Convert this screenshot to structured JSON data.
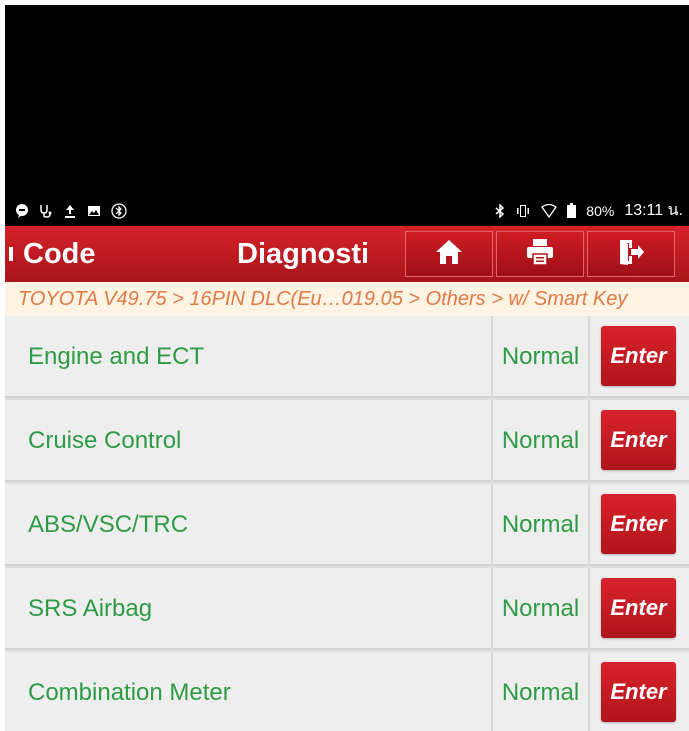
{
  "statusbar": {
    "left_icons": [
      "message-icon",
      "stethoscope-icon",
      "upload-icon",
      "image-icon",
      "bluetooth-circle-icon"
    ],
    "right_icons": [
      "bluetooth-icon",
      "vibrate-icon",
      "wifi-icon",
      "battery-icon"
    ],
    "battery": "80%",
    "time": "13:11 น."
  },
  "titlebar": {
    "left_title": "Code",
    "center_title": "Diagnosti",
    "buttons": [
      "home-icon",
      "print-icon",
      "exit-icon"
    ]
  },
  "breadcrumb": "TOYOTA V49.75 > 16PIN DLC(Eu…019.05 > Others > w/ Smart Key",
  "systems": [
    {
      "name": "Engine and ECT",
      "status": "Normal",
      "action": "Enter"
    },
    {
      "name": "Cruise Control",
      "status": "Normal",
      "action": "Enter"
    },
    {
      "name": "ABS/VSC/TRC",
      "status": "Normal",
      "action": "Enter"
    },
    {
      "name": "SRS Airbag",
      "status": "Normal",
      "action": "Enter"
    },
    {
      "name": "Combination Meter",
      "status": "Normal",
      "action": "Enter"
    }
  ],
  "colors": {
    "header_red": "#c41a22",
    "text_green": "#2e9b45",
    "breadcrumb_orange": "#e07a47",
    "breadcrumb_bg": "#fff3e3"
  }
}
